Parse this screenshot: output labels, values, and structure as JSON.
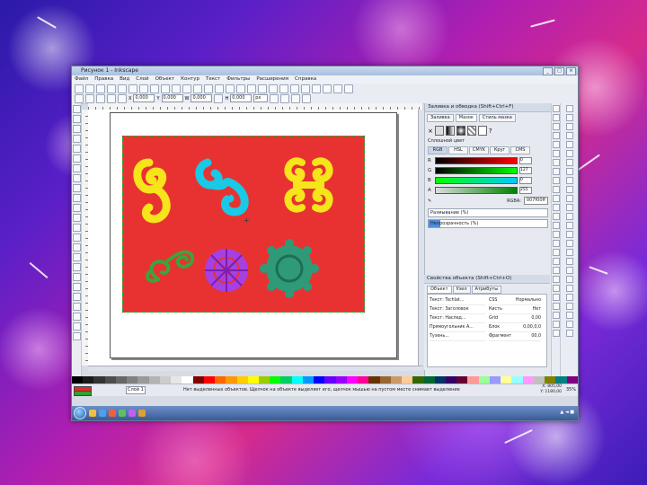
{
  "app": {
    "title": "Рисунок 1 - Inkscape",
    "menu": [
      "Файл",
      "Правка",
      "Вид",
      "Слой",
      "Объект",
      "Контур",
      "Текст",
      "Фильтры",
      "Расширения",
      "Справка"
    ]
  },
  "controls": {
    "x_value": "0,000",
    "y_value": "0,000",
    "w_value": "0,000",
    "h_value": "0,000",
    "unit": "px"
  },
  "fill_stroke_panel": {
    "title": "Заливка и обводка (Shift+Ctrl+F)",
    "tabs": [
      "Заливка",
      "Мазок",
      "Стиль мазка"
    ],
    "paint_label": "Сплошной цвет",
    "modes": [
      "RGB",
      "HSL",
      "CMYK",
      "Круг",
      "CMS"
    ],
    "channels": [
      {
        "label": "R",
        "value": "0",
        "gradient": "linear-gradient(90deg,#000,#ff0000)"
      },
      {
        "label": "G",
        "value": "127",
        "gradient": "linear-gradient(90deg,#000,#00ff00)"
      },
      {
        "label": "B",
        "value": "0",
        "gradient": "linear-gradient(90deg,#00ff00,#00c8ff)"
      },
      {
        "label": "A",
        "value": "255",
        "gradient": "linear-gradient(90deg,#ddd,#008000)"
      }
    ],
    "rgba_label": "RGBA:",
    "rgba_value": "007f00ff",
    "blur_label": "Размывание (%)",
    "opacity_label": "Непрозрачность (%)"
  },
  "objects_panel": {
    "title": "Свойства объекта (Shift+Ctrl+O)",
    "tabs": [
      "Объект",
      "Узел",
      "Атрибуты"
    ],
    "list": [
      "Текст: Tschlat...",
      "Текст: Заголовок",
      "Текст: Наслед...",
      "Прямоугольник А...",
      "Тузень..."
    ],
    "props": [
      {
        "k": "CSS",
        "v": "Нормально"
      },
      {
        "k": "Кисть",
        "v": "Нет"
      },
      {
        "k": "Grid",
        "v": "0,00"
      },
      {
        "k": "Блок",
        "v": "0,00,0,0"
      },
      {
        "k": "Фрагмент",
        "v": "00,0"
      }
    ]
  },
  "status": {
    "layer": "Слой 1",
    "message": "Нет выделенных объектов. Щелчок на объекте выделяет его, щелчок мышью на пустом месте снимает выделение",
    "x": "X: 805,00",
    "y": "Y: 1180,00",
    "zoom": "35%"
  },
  "artwork": {
    "background": "#e83232",
    "border": "#3aa53a",
    "shapes": [
      {
        "name": "yellow-spiral-ornament",
        "color": "#f5e51a"
      },
      {
        "name": "cyan-scroll-ornament",
        "color": "#19c9e6"
      },
      {
        "name": "yellow-double-scroll-ornament",
        "color": "#f5e51a"
      },
      {
        "name": "green-spiral-ornament",
        "color": "#3aa53a"
      },
      {
        "name": "violet-flower-rosette",
        "color": "#a640e0"
      },
      {
        "name": "teal-star-rosette",
        "color": "#2e9a78"
      }
    ]
  },
  "palette": [
    "#000000",
    "#1a1a1a",
    "#333",
    "#4d4d4d",
    "#666",
    "#808080",
    "#999",
    "#b3b3b3",
    "#ccc",
    "#e6e6e6",
    "#fff",
    "#800000",
    "#ff0000",
    "#ff6600",
    "#ff9900",
    "#ffcc00",
    "#ffff00",
    "#99cc00",
    "#00ff00",
    "#00cc66",
    "#00ffff",
    "#0099ff",
    "#0000ff",
    "#6600ff",
    "#9900ff",
    "#ff00ff",
    "#ff0099",
    "#663300",
    "#996633",
    "#cc9966",
    "#ffcc99",
    "#336600",
    "#006633",
    "#003366",
    "#330066",
    "#660033",
    "#ff9999",
    "#99ff99",
    "#9999ff",
    "#ffff99",
    "#99ffff",
    "#ff99ff",
    "#c0c0c0",
    "#808000",
    "#008080",
    "#800080"
  ]
}
